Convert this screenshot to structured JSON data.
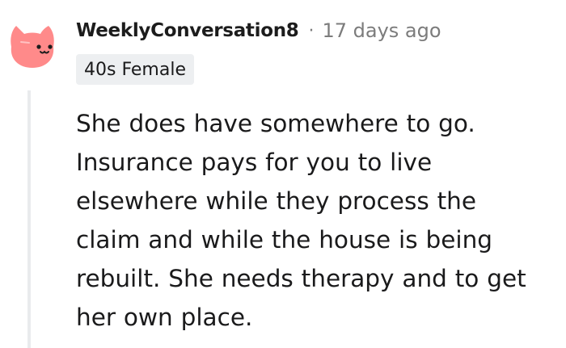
{
  "comment": {
    "author": "WeeklyConversation8",
    "separator": "·",
    "timestamp": "17 days ago",
    "flair": "40s Female",
    "body_lines": [
      "She does have somewhere to go.",
      "Insurance pays for you to live",
      "elsewhere while they process the",
      "claim and while the house is being",
      "rebuilt. She needs therapy and to get",
      "her own place."
    ]
  },
  "avatar": {
    "icon": "pink-cat-avatar-icon",
    "color": "#ff8a8a"
  },
  "colors": {
    "thread_line": "#e9ebed",
    "meta_text": "#7c7c7c",
    "flair_background": "#edeff1"
  }
}
